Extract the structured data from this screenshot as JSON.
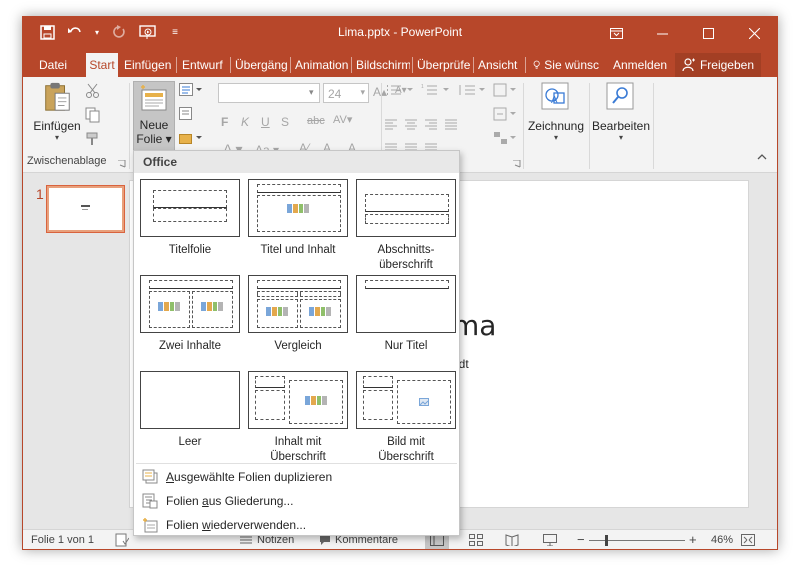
{
  "window": {
    "title": "Lima.pptx - PowerPoint",
    "accent": "#b7472a"
  },
  "qat": {
    "save_icon": "save-icon",
    "undo_icon": "undo-icon",
    "redo_icon": "redo-icon",
    "start_icon": "slideshow-icon",
    "customize_icon": "customize-icon"
  },
  "tabs": [
    "Datei",
    "Start",
    "Einfügen",
    "Entwurf",
    "Übergäng",
    "Animation",
    "Bildschirm",
    "Überprüfe",
    "Ansicht"
  ],
  "tell_me": "Sie wünsc",
  "signin": "Anmelden",
  "share": "Freigeben",
  "ribbon": {
    "paste_label": "Einfügen",
    "clipboard_group": "Zwischenablage",
    "new_slide_line1": "Neue",
    "new_slide_line2": "Folie",
    "font_size": "24",
    "bold": "F",
    "italic": "K",
    "underline": "U",
    "shadow": "S",
    "strike": "abc",
    "drawing_label": "Zeichnung",
    "editing_label": "Bearbeiten"
  },
  "slide": {
    "number": "1",
    "title": "ma",
    "subtitle": "adt"
  },
  "dropdown": {
    "header": "Office",
    "layouts": [
      {
        "line1": "Titelfolie",
        "line2": ""
      },
      {
        "line1": "Titel und Inhalt",
        "line2": ""
      },
      {
        "line1": "Abschnitts-",
        "line2": "überschrift"
      },
      {
        "line1": "Zwei Inhalte",
        "line2": ""
      },
      {
        "line1": "Vergleich",
        "line2": ""
      },
      {
        "line1": "Nur Titel",
        "line2": ""
      },
      {
        "line1": "Leer",
        "line2": ""
      },
      {
        "line1": "Inhalt mit",
        "line2": "Überschrift"
      },
      {
        "line1": "Bild mit",
        "line2": "Überschrift"
      }
    ],
    "actions": [
      {
        "pre": "",
        "key": "A",
        "post": "usgewählte Folien duplizieren"
      },
      {
        "pre": "Folien ",
        "key": "a",
        "post": "us Gliederung..."
      },
      {
        "pre": "Folien ",
        "key": "w",
        "post": "iederverwenden..."
      }
    ]
  },
  "status": {
    "slide_of": "Folie 1 von 1",
    "notes": "Notizen",
    "comments": "Kommentare",
    "zoom": "46%",
    "minus": "−",
    "plus": "+"
  }
}
